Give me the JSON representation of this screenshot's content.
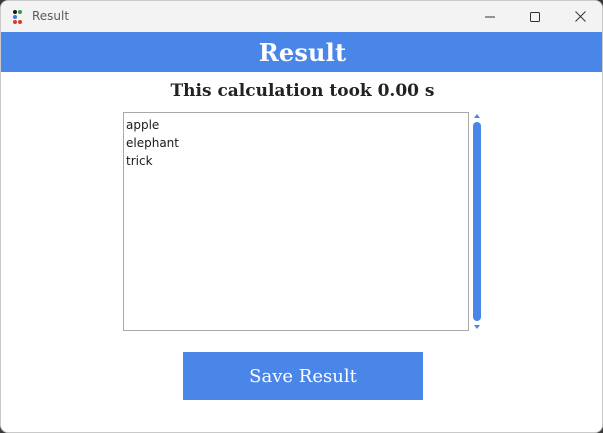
{
  "window": {
    "title": "Result",
    "app_icon": "colored-dots-icon",
    "controls": {
      "minimize_icon": "minimize-icon",
      "maximize_icon": "maximize-icon",
      "close_icon": "close-icon"
    }
  },
  "header": {
    "title": "Result"
  },
  "main": {
    "calc_time_text": "This calculation took 0.00 s",
    "result_lines": [
      "apple",
      "elephant",
      "trick"
    ],
    "save_label": "Save Result"
  },
  "colors": {
    "accent": "#4a86e8",
    "titlebar_bg": "#f3f3f3",
    "text_dark": "#222222"
  }
}
